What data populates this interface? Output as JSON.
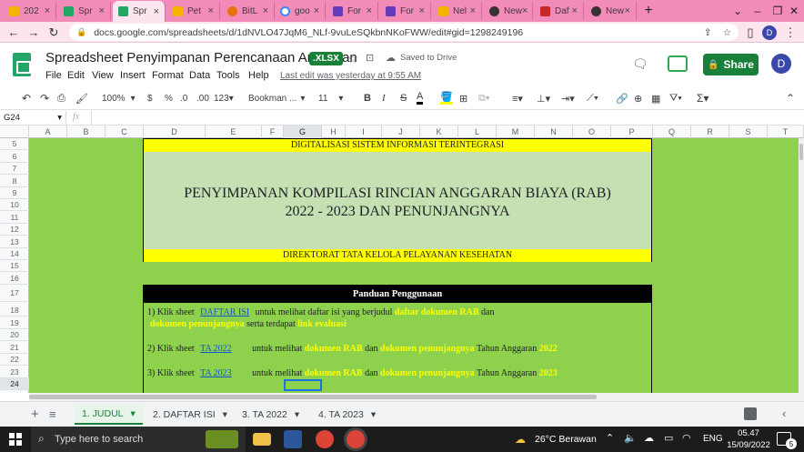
{
  "browser": {
    "tabs": [
      {
        "label": "202",
        "color": "#f4b400"
      },
      {
        "label": "Spr",
        "color": "#23a566"
      },
      {
        "label": "Spr",
        "color": "#23a566"
      },
      {
        "label": "Pet",
        "color": "#f4b400"
      },
      {
        "label": "BitL",
        "color": "#e8710a"
      },
      {
        "label": "goo",
        "color": "#4285f4"
      },
      {
        "label": "For",
        "color": "#673ab7"
      },
      {
        "label": "For",
        "color": "#673ab7"
      },
      {
        "label": "Nel",
        "color": "#f4b400"
      },
      {
        "label": "New",
        "color": "#333333"
      },
      {
        "label": "Daf",
        "color": "#c62828"
      },
      {
        "label": "New",
        "color": "#333333"
      }
    ],
    "new_tab": "+",
    "url": "docs.google.com/spreadsheets/d/1dNVLO47JqM6_NLf-9vuLeSQkbnNKoFWW/edit#gid=1298249196",
    "profile": "D"
  },
  "doc": {
    "title": "Spreadsheet Penyimpanan Perencanaan Anggaran",
    "format_badge": ".XLSX",
    "saved_status": "Saved to Drive",
    "menus": [
      "File",
      "Edit",
      "View",
      "Insert",
      "Format",
      "Data",
      "Tools",
      "Help"
    ],
    "last_edit": "Last edit was yesterday at 9:55 AM",
    "share_label": "Share",
    "avatar": "D"
  },
  "toolbar": {
    "zoom": "100%",
    "currency": "$",
    "percent": "%",
    "dec_less": ".0",
    "dec_more": ".00",
    "number_format": "123",
    "font": "Bookman ...",
    "font_size": "11",
    "bold": "B",
    "italic": "I",
    "strike": "S",
    "text_color": "A",
    "sum": "Σ"
  },
  "formula": {
    "name_box": "G24",
    "fx": "fx",
    "value": ""
  },
  "columns": [
    "A",
    "B",
    "C",
    "D",
    "E",
    "F",
    "G",
    "H",
    "I",
    "J",
    "K",
    "L",
    "M",
    "N",
    "O",
    "P",
    "Q",
    "R",
    "S",
    "T"
  ],
  "rows": [
    "5",
    "6",
    "7",
    "8",
    "9",
    "10",
    "11",
    "12",
    "13",
    "14",
    "15",
    "16",
    "17",
    "18",
    "19",
    "20",
    "21",
    "22",
    "23",
    "24"
  ],
  "sheet": {
    "header_band_top": "DIGITALISASI SISTEM INFORMASI TERINTEGRASI",
    "main_title_line1": "PENYIMPANAN KOMPILASI RINCIAN ANGGARAN BIAYA (RAB)",
    "main_title_line2": "2022 - 2023 DAN PENUNJANGNYA",
    "header_band_bottom": "DIREKTORAT TATA KELOLA PELAYANAN KESEHATAN",
    "guide_title": "Panduan Penggunaan",
    "guide": {
      "l1_a": "1) Klik sheet",
      "l1_link": "DAFTAR ISI",
      "l1_b": "untuk melihat daftar isi yang berjudul",
      "l1_c": "daftar dokumen RAB",
      "l1_d": "dan",
      "l2_a": "dokumen penunjangnya",
      "l2_b": "serta terdapat",
      "l2_c": "link evaluasi",
      "l3_a": "2) Klik sheet",
      "l3_link": "TA 2022",
      "l3_b": "untuk melihat",
      "l3_c": "dokumen RAB",
      "l3_d": "dan",
      "l3_e": "dokumen penunjangnya",
      "l3_f": "Tahun Anggaran",
      "l3_g": "2022",
      "l4_a": "3) Klik sheet",
      "l4_link": "TA 2023",
      "l4_b": "untuk melihat",
      "l4_c": "dokumen RAB",
      "l4_d": "dan",
      "l4_e": "dokumen penunjangnya",
      "l4_f": "Tahun Anggaran",
      "l4_g": "2023"
    },
    "colors": {
      "background": "#8dd14d",
      "band": "#ffff00",
      "title_box": "#c5e0b3",
      "guide_header": "#000000",
      "highlight": "#ffff00",
      "link": "#1155cc"
    }
  },
  "sheet_tabs": [
    "1. JUDUL",
    "2. DAFTAR ISI",
    "3. TA 2022",
    "4. TA 2023"
  ],
  "taskbar": {
    "search_placeholder": "Type here to search",
    "weather": "26°C Berawan",
    "lang": "ENG",
    "time": "05.47",
    "date": "15/09/2022",
    "notifications": "5"
  }
}
